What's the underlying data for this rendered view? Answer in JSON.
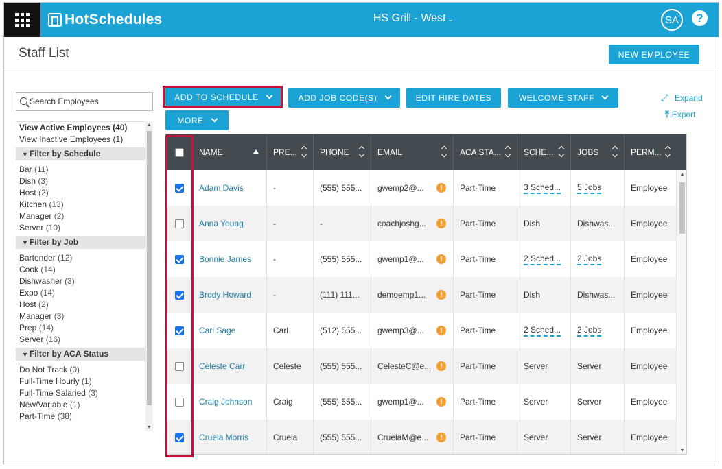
{
  "app": {
    "brand": "HotSchedules",
    "location": "HS Grill - West",
    "user_initials": "SA",
    "help_label": "?"
  },
  "page": {
    "title": "Staff List",
    "new_employee_label": "NEW EMPLOYEE"
  },
  "search": {
    "placeholder": "Search Employees"
  },
  "sidebar": {
    "views": [
      {
        "label": "View Active Employees",
        "count": "(40)"
      },
      {
        "label": "View Inactive Employees",
        "count": "(1)"
      }
    ],
    "groups": [
      {
        "title": "Filter by Schedule",
        "items": [
          {
            "label": "Bar",
            "count": "(11)"
          },
          {
            "label": "Dish",
            "count": "(3)"
          },
          {
            "label": "Host",
            "count": "(2)"
          },
          {
            "label": "Kitchen",
            "count": "(13)"
          },
          {
            "label": "Manager",
            "count": "(2)"
          },
          {
            "label": "Server",
            "count": "(10)"
          }
        ]
      },
      {
        "title": "Filter by Job",
        "items": [
          {
            "label": "Bartender",
            "count": "(12)"
          },
          {
            "label": "Cook",
            "count": "(14)"
          },
          {
            "label": "Dishwasher",
            "count": "(3)"
          },
          {
            "label": "Expo",
            "count": "(14)"
          },
          {
            "label": "Host",
            "count": "(2)"
          },
          {
            "label": "Manager",
            "count": "(3)"
          },
          {
            "label": "Prep",
            "count": "(14)"
          },
          {
            "label": "Server",
            "count": "(16)"
          }
        ]
      },
      {
        "title": "Filter by ACA Status",
        "items": [
          {
            "label": "Do Not Track",
            "count": "(0)"
          },
          {
            "label": "Full-Time Hourly",
            "count": "(1)"
          },
          {
            "label": "Full-Time Salaried",
            "count": "(3)"
          },
          {
            "label": "New/Variable",
            "count": "(1)"
          },
          {
            "label": "Part-Time",
            "count": "(38)"
          }
        ]
      }
    ]
  },
  "toolbar": {
    "add_to_schedule": "ADD TO SCHEDULE",
    "add_job_codes": "ADD JOB CODE(S)",
    "edit_hire_dates": "EDIT HIRE DATES",
    "welcome_staff": "WELCOME STAFF",
    "more": "MORE",
    "expand": "Expand",
    "export": "Export"
  },
  "table": {
    "columns": [
      "NAME",
      "PRE...",
      "PHONE",
      "EMAIL",
      "ACA STA...",
      "SCHE...",
      "JOBS",
      "PERM..."
    ],
    "rows": [
      {
        "checked": true,
        "name": "Adam Davis",
        "preferred": "-",
        "phone": "(555) 555...",
        "email": "gwemp2@...",
        "aca": "Part-Time",
        "schedule": "3 Sched...",
        "schedule_link": true,
        "jobs": "5 Jobs",
        "jobs_link": true,
        "perm": "Employee"
      },
      {
        "checked": false,
        "name": "Anna Young",
        "preferred": "-",
        "phone": "-",
        "email": "coachjoshg...",
        "aca": "Part-Time",
        "schedule": "Dish",
        "schedule_link": false,
        "jobs": "Dishwas...",
        "jobs_link": false,
        "perm": "Employee"
      },
      {
        "checked": true,
        "name": "Bonnie James",
        "preferred": "-",
        "phone": "(555) 555...",
        "email": "gwemp1@...",
        "aca": "Part-Time",
        "schedule": "2 Sched...",
        "schedule_link": true,
        "jobs": "2 Jobs",
        "jobs_link": true,
        "perm": "Employee"
      },
      {
        "checked": true,
        "name": "Brody Howard",
        "preferred": "-",
        "phone": "(111) 111...",
        "email": "demoemp1...",
        "aca": "Part-Time",
        "schedule": "Dish",
        "schedule_link": false,
        "jobs": "Dishwas...",
        "jobs_link": false,
        "perm": "Employee"
      },
      {
        "checked": true,
        "name": "Carl Sage",
        "preferred": "Carl",
        "phone": "(512) 555...",
        "email": "gwemp3@...",
        "aca": "Part-Time",
        "schedule": "2 Sched...",
        "schedule_link": true,
        "jobs": "2 Jobs",
        "jobs_link": true,
        "perm": "Employee"
      },
      {
        "checked": false,
        "name": "Celeste Carr",
        "preferred": "Celeste",
        "phone": "(555) 555...",
        "email": "CelesteC@e...",
        "aca": "Part-Time",
        "schedule": "Server",
        "schedule_link": false,
        "jobs": "Server",
        "jobs_link": false,
        "perm": "Employee"
      },
      {
        "checked": false,
        "name": "Craig Johnson",
        "preferred": "Craig",
        "phone": "(555) 555...",
        "email": "gwemp1@...",
        "aca": "Part-Time",
        "schedule": "Server",
        "schedule_link": false,
        "jobs": "Server",
        "jobs_link": false,
        "perm": "Employee"
      },
      {
        "checked": true,
        "name": "Cruela Morris",
        "preferred": "Cruela",
        "phone": "(555) 555...",
        "email": "CruelaM@e...",
        "aca": "Part-Time",
        "schedule": "Server",
        "schedule_link": false,
        "jobs": "Server",
        "jobs_link": false,
        "perm": "Employee"
      }
    ],
    "warning_glyph": "!"
  },
  "colors": {
    "brand": "#1aa3d4",
    "header_dark": "#434a50",
    "highlight": "#c0143c",
    "checkbox": "#1a73e8",
    "warning": "#f0a030"
  }
}
